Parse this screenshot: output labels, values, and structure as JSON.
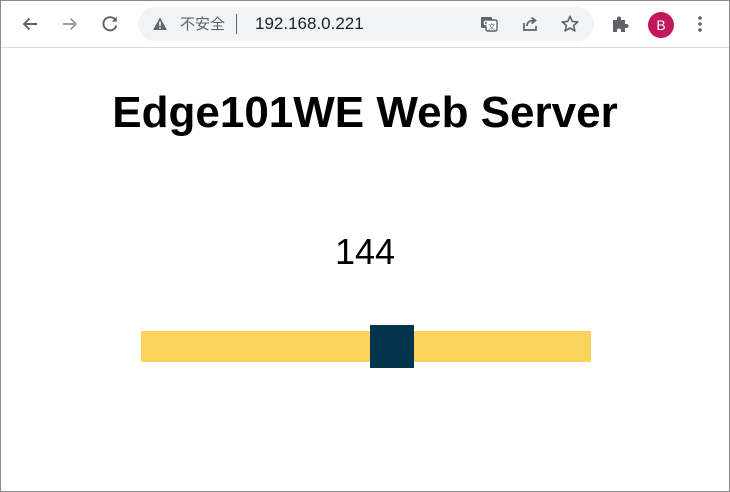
{
  "browser": {
    "address": {
      "security_label": "不安全",
      "url": "192.168.0.221"
    },
    "icons": {
      "back": "back-arrow-icon",
      "forward": "forward-arrow-icon",
      "reload": "reload-icon",
      "warning": "warning-triangle-icon",
      "translate": "translate-icon",
      "share": "share-icon",
      "bookmark": "star-icon",
      "extensions": "puzzle-icon",
      "menu": "kebab-menu-icon"
    },
    "profile": {
      "initial": "B",
      "color": "#c2185b"
    }
  },
  "page": {
    "title": "Edge101WE Web Server",
    "value": "144",
    "slider": {
      "value": 144,
      "min": 0,
      "max": 255,
      "track_color": "#fdd45b",
      "thumb_color": "#04344e"
    }
  }
}
